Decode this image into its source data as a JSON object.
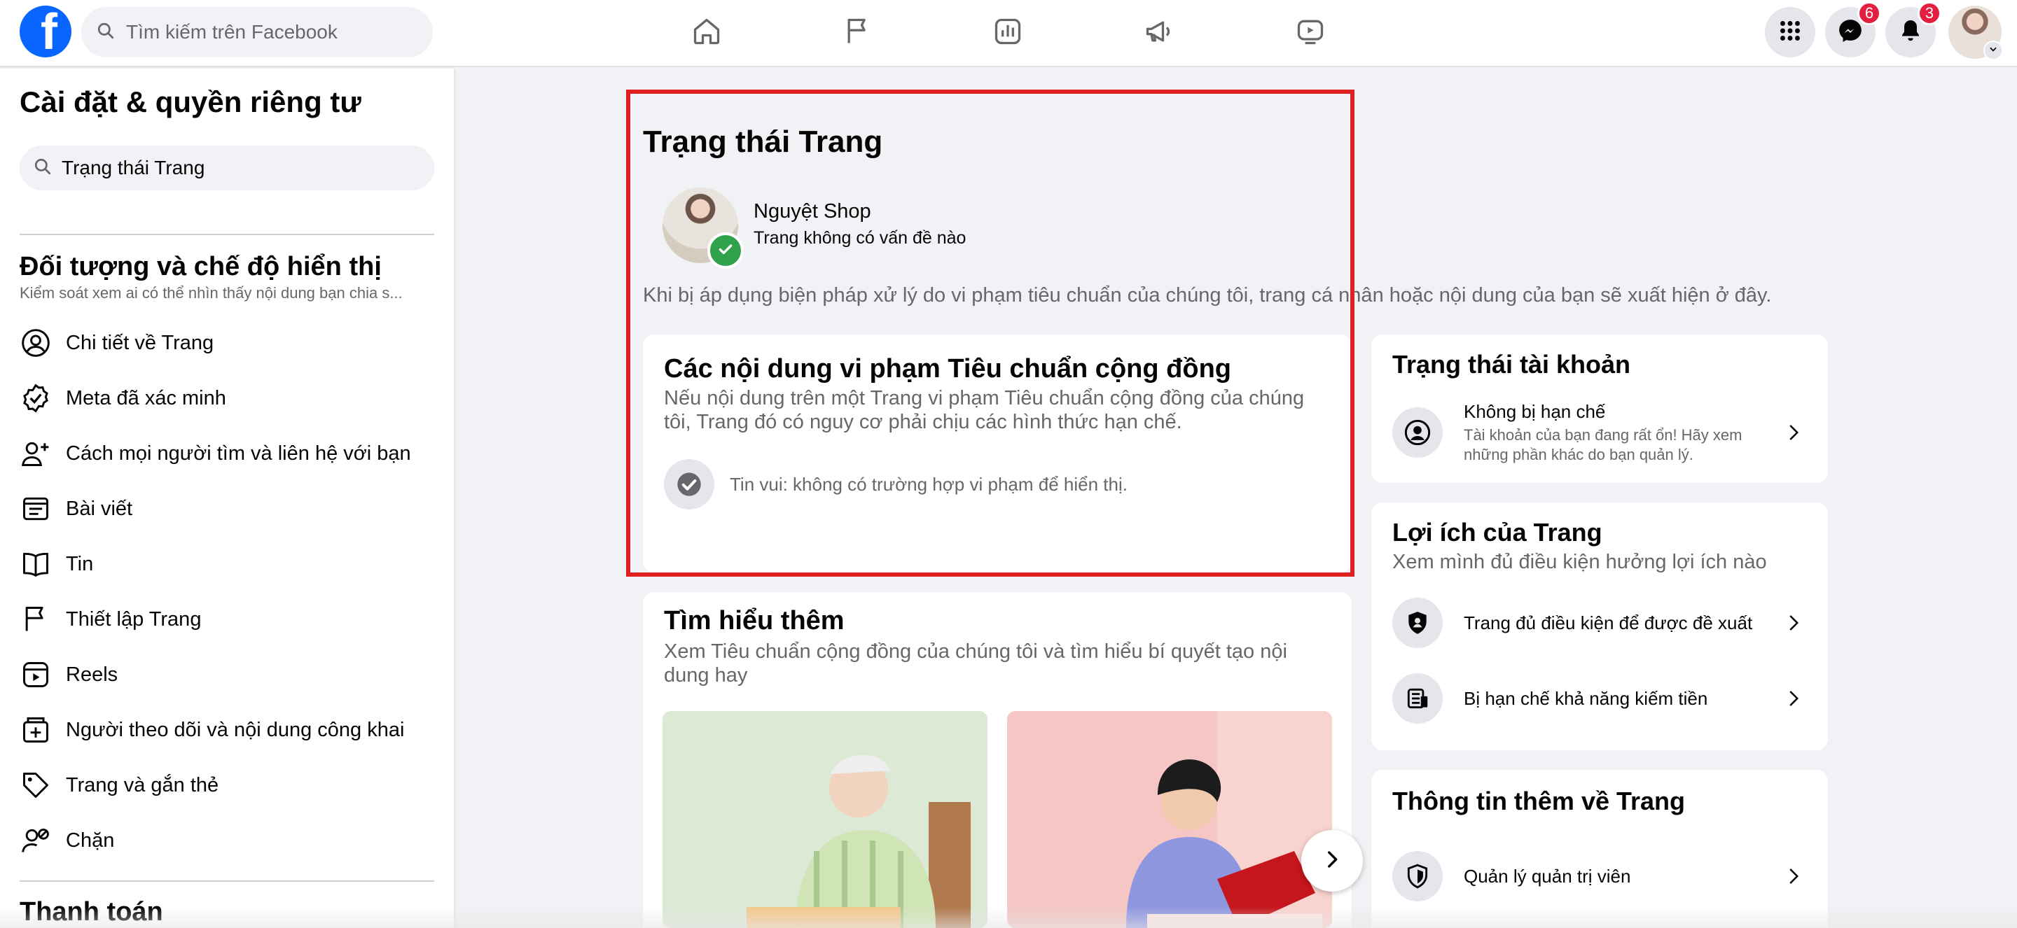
{
  "topbar": {
    "logo_letter": "f",
    "search_placeholder": "Tìm kiếm trên Facebook",
    "messenger_badge": "6",
    "notifications_badge": "3"
  },
  "sidebar": {
    "title": "Cài đặt & quyền riêng tư",
    "search_value": "Trạng thái Trang",
    "section1_title": "Đối tượng và chế độ hiển thị",
    "section1_desc": "Kiểm soát xem ai có thể nhìn thấy nội dung bạn chia s...",
    "items": [
      {
        "label": "Chi tiết về Trang",
        "icon": "user-circle-icon"
      },
      {
        "label": "Meta đã xác minh",
        "icon": "verified-badge-icon"
      },
      {
        "label": "Cách mọi người tìm và liên hệ với bạn",
        "icon": "person-add-icon"
      },
      {
        "label": "Bài viết",
        "icon": "post-icon"
      },
      {
        "label": "Tin",
        "icon": "book-open-icon"
      },
      {
        "label": "Thiết lập Trang",
        "icon": "flag-icon"
      },
      {
        "label": "Reels",
        "icon": "reels-icon"
      },
      {
        "label": "Người theo dõi và nội dung công khai",
        "icon": "followers-icon"
      },
      {
        "label": "Trang và gắn thẻ",
        "icon": "tag-icon"
      },
      {
        "label": "Chặn",
        "icon": "block-user-icon"
      }
    ],
    "section2_title": "Thanh toán"
  },
  "main": {
    "title": "Trạng thái Trang",
    "page_name": "Nguyệt Shop",
    "page_status": "Trang không có vấn đề nào",
    "intro": "Khi bị áp dụng biện pháp xử lý do vi phạm tiêu chuẩn của chúng tôi, trang cá nhân hoặc nội dung của bạn sẽ xuất hiện ở đây.",
    "violations": {
      "title": "Các nội dung vi phạm Tiêu chuẩn cộng đồng",
      "desc": "Nếu nội dung trên một Trang vi phạm Tiêu chuẩn cộng đồng của chúng tôi, Trang đó có nguy cơ phải chịu các hình thức hạn chế.",
      "empty": "Tin vui: không có trường hợp vi phạm để hiển thị."
    },
    "learn_more": {
      "title": "Tìm hiểu thêm",
      "desc": "Xem Tiêu chuẩn cộng đồng của chúng tôi và tìm hiểu bí quyết tạo nội dung hay"
    }
  },
  "right": {
    "account": {
      "title": "Trạng thái tài khoản",
      "row_label": "Không bị hạn chế",
      "row_sub": "Tài khoản của bạn đang rất ổn! Hãy xem những phần khác do bạn quản lý."
    },
    "benefits": {
      "title": "Lợi ích của Trang",
      "desc": "Xem mình đủ điều kiện hưởng lợi ích nào",
      "rows": [
        "Trang đủ điều kiện để được đề xuất",
        "Bị hạn chế khả năng kiếm tiền"
      ]
    },
    "info": {
      "title": "Thông tin thêm về Trang",
      "rows": [
        "Quản lý quản trị viên"
      ]
    }
  },
  "colors": {
    "brand": "#0866ff",
    "badge": "#e41e3f",
    "success": "#31a24c",
    "highlight": "#e02020"
  }
}
